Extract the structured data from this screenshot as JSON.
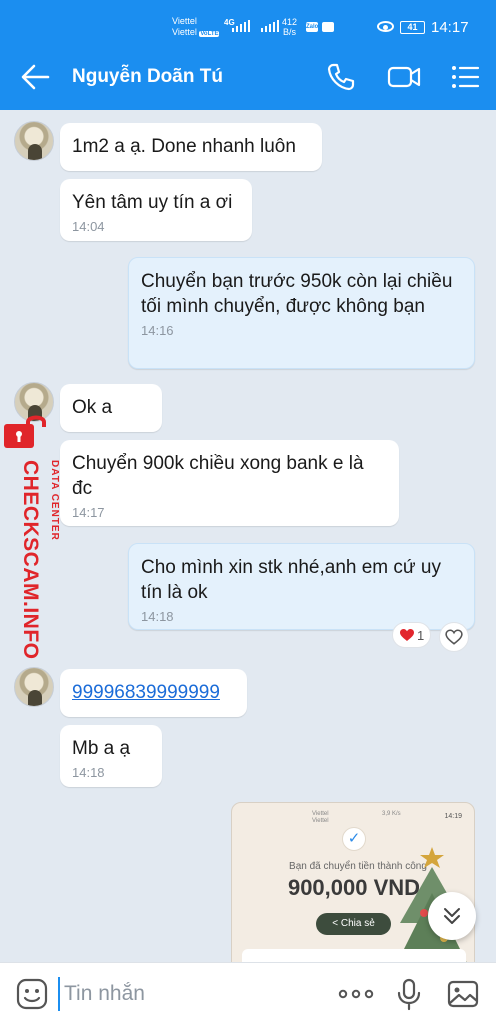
{
  "status_bar": {
    "carrier_1": "Viettel",
    "carrier_2": "Viettel",
    "volte": "VoLTE",
    "network": "4G",
    "speed_value": "412",
    "speed_unit": "B/s",
    "zalo_badge": "Zalo",
    "battery": "41",
    "time": "14:17"
  },
  "header": {
    "contact_name": "Nguyễn Doãn Tú",
    "back_icon": "arrow-left-icon",
    "call_icon": "phone-icon",
    "video_icon": "video-icon",
    "menu_icon": "list-menu-icon"
  },
  "messages": [
    {
      "direction": "in",
      "text": "1m2 a ạ. Done nhanh luôn",
      "time": ""
    },
    {
      "direction": "in",
      "text": "Yên tâm uy tín a ơi",
      "time": "14:04"
    },
    {
      "direction": "out",
      "text": "Chuyển bạn trước 950k còn lại chiều tối mình chuyển, được không bạn",
      "time": "14:16"
    },
    {
      "direction": "in",
      "text": "Ok a",
      "time": ""
    },
    {
      "direction": "in",
      "text": "Chuyển 900k chiều xong bank e là đc",
      "time": "14:17"
    },
    {
      "direction": "out",
      "text": "Cho mình xin stk nhé,anh em cứ uy tín là ok",
      "time": "14:18"
    },
    {
      "direction": "in",
      "text": "99996839999999",
      "time": "",
      "is_link": true
    },
    {
      "direction": "in",
      "text": "Mb a ạ",
      "time": "14:18"
    }
  ],
  "reaction": {
    "count": "1"
  },
  "transfer_image": {
    "status_carrier_1": "Viettel",
    "status_carrier_2": "Viettel",
    "status_speed": "3,9 K/s",
    "time": "14:19",
    "title": "Bạn đã chuyển tiền thành công",
    "amount": "900,000 VND",
    "share_label": "Chia sẻ"
  },
  "watermark": {
    "main": "CHECKSCAM.INFO",
    "sub": "DATA CENTER"
  },
  "input_bar": {
    "placeholder": "Tin nhắn",
    "more_label": "ooo"
  },
  "colors": {
    "brand_blue": "#1b8ef0",
    "chat_bg": "#e2e9f1",
    "outgoing_bubble": "#e4f1fc",
    "watermark_red": "#e0252a"
  }
}
